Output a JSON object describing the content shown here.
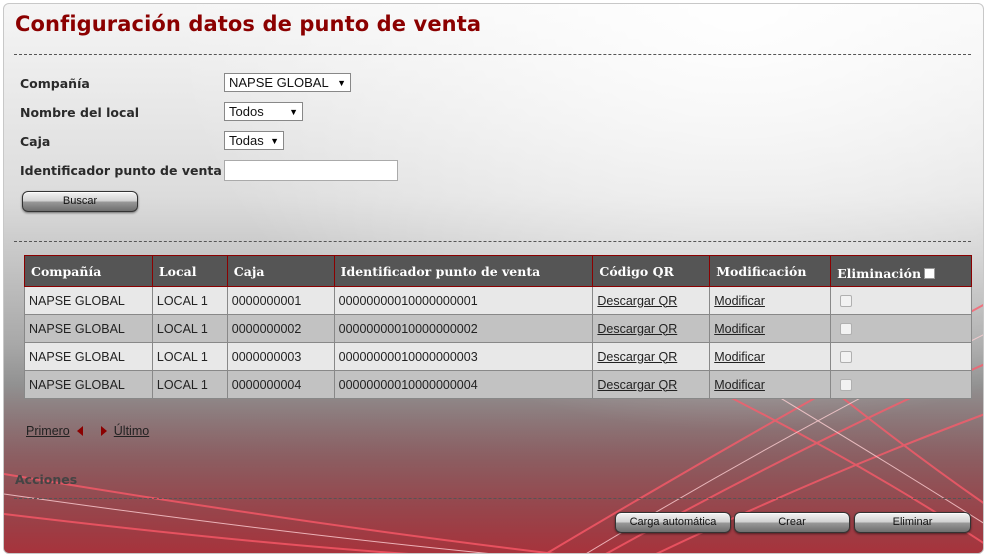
{
  "page": {
    "title": "Configuración datos de punto de venta"
  },
  "filters": {
    "company_label": "Compañía",
    "company_value": "NAPSE GLOBAL",
    "store_label": "Nombre del local",
    "store_value": "Todos",
    "register_label": "Caja",
    "register_value": "Todas",
    "pos_id_label": "Identificador punto de venta",
    "pos_id_value": "",
    "search_button": "Buscar"
  },
  "table": {
    "headers": {
      "company": "Compañía",
      "store": "Local",
      "register": "Caja",
      "pos_id": "Identificador punto de venta",
      "qr": "Código QR",
      "modify": "Modificación",
      "delete": "Eliminación"
    },
    "rows": [
      {
        "company": "NAPSE GLOBAL",
        "store": "LOCAL 1",
        "register": "0000000001",
        "pos_id": "00000000010000000001",
        "qr": "Descargar QR",
        "modify": "Modificar"
      },
      {
        "company": "NAPSE GLOBAL",
        "store": "LOCAL 1",
        "register": "0000000002",
        "pos_id": "00000000010000000002",
        "qr": "Descargar QR",
        "modify": "Modificar"
      },
      {
        "company": "NAPSE GLOBAL",
        "store": "LOCAL 1",
        "register": "0000000003",
        "pos_id": "00000000010000000003",
        "qr": "Descargar QR",
        "modify": "Modificar"
      },
      {
        "company": "NAPSE GLOBAL",
        "store": "LOCAL 1",
        "register": "0000000004",
        "pos_id": "00000000010000000004",
        "qr": "Descargar QR",
        "modify": "Modificar"
      }
    ]
  },
  "pager": {
    "first": "Primero",
    "last": "Último"
  },
  "actions": {
    "section_label": "Acciones",
    "auto_load_button": "Carga automática",
    "create_button": "Crear",
    "delete_button": "Eliminar"
  },
  "colors": {
    "title": "#8b0000",
    "header_bg": "#555555",
    "header_border": "#8b0000",
    "row_odd": "#e8e8e8",
    "row_even": "#c2c2c2"
  }
}
